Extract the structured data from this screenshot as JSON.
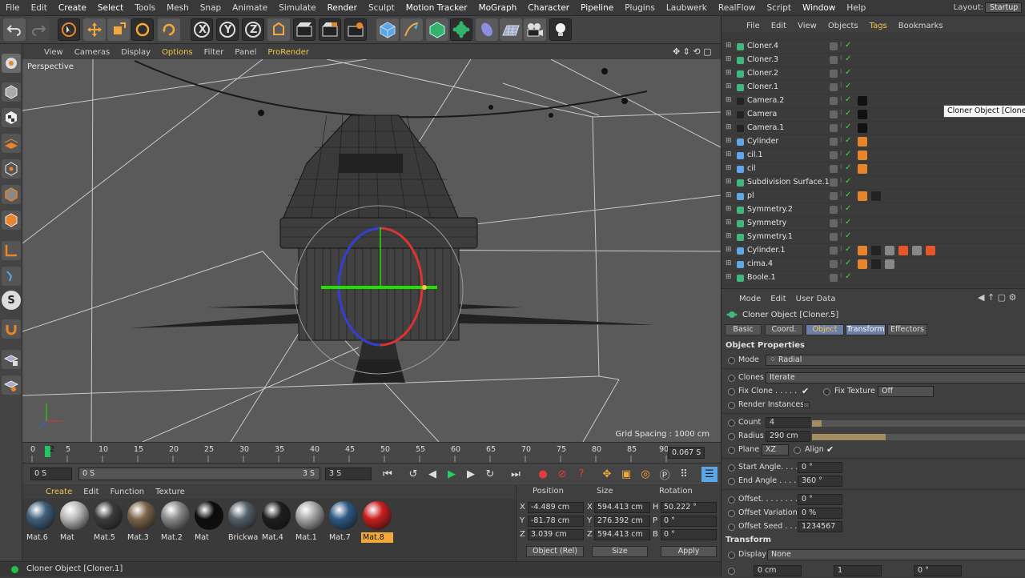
{
  "menu": [
    "File",
    "Edit",
    "Create",
    "Select",
    "Tools",
    "Mesh",
    "Snap",
    "Animate",
    "Simulate",
    "Render",
    "Sculpt",
    "Motion Tracker",
    "MoGraph",
    "Character",
    "Pipeline",
    "Plugins",
    "Laubwerk",
    "RealFlow",
    "Script",
    "Window",
    "Help"
  ],
  "layout": {
    "label": "Layout:",
    "value": "Startup"
  },
  "toolbar_axes": [
    "X",
    "Y",
    "Z"
  ],
  "viewport_menu": [
    "View",
    "Cameras",
    "Display",
    "Options",
    "Filter",
    "Panel",
    "ProRender"
  ],
  "viewport": {
    "label": "Perspective",
    "grid_spacing": "Grid Spacing : 1000 cm"
  },
  "timeline": {
    "ticks": [
      "0",
      "2",
      "5",
      "10",
      "15",
      "20",
      "25",
      "30",
      "35",
      "40",
      "45",
      "50",
      "55",
      "60",
      "65",
      "70",
      "75",
      "80",
      "85",
      "90"
    ],
    "current_frame": "2",
    "frame_field": "0.067 S"
  },
  "transport": {
    "start": "0 S",
    "range_start": "0 S",
    "range_end": "3 S",
    "end": "3 S"
  },
  "material_menu": [
    "Create",
    "Edit",
    "Function",
    "Texture"
  ],
  "materials": [
    {
      "name": "Mat.6",
      "color": "#3f5f7c"
    },
    {
      "name": "Mat",
      "color": "#b9b9b9"
    },
    {
      "name": "Mat.5",
      "color": "#3b3b3b"
    },
    {
      "name": "Mat.3",
      "color": "#7a6548"
    },
    {
      "name": "Mat.2",
      "color": "#8a8a8a"
    },
    {
      "name": "Mat",
      "color": "#0c0c0c"
    },
    {
      "name": "Brickwa",
      "color": "#55606a"
    },
    {
      "name": "Mat.4",
      "color": "#1d1d1d"
    },
    {
      "name": "Mat.1",
      "color": "#a7a7a7"
    },
    {
      "name": "Mat.7",
      "color": "#2d5a85"
    },
    {
      "name": "Mat.8",
      "color": "#c81e1e"
    }
  ],
  "selected_material": "Mat.8",
  "coords": {
    "headers": [
      "Position",
      "Size",
      "Rotation"
    ],
    "rows": [
      {
        "axis": "X",
        "pos": "-4.489 cm",
        "size_axis": "X",
        "size": "594.413 cm",
        "rot_axis": "H",
        "rot": "50.222 °"
      },
      {
        "axis": "Y",
        "pos": "-81.78 cm",
        "size_axis": "Y",
        "size": "276.392 cm",
        "rot_axis": "P",
        "rot": "0 °"
      },
      {
        "axis": "Z",
        "pos": "3.039 cm",
        "size_axis": "Z",
        "size": "594.413 cm",
        "rot_axis": "B",
        "rot": "0 °"
      }
    ],
    "mode": "Object (Rel)",
    "size_mode": "Size",
    "apply": "Apply"
  },
  "status": "Cloner Object [Cloner.1]",
  "object_menu": [
    "File",
    "Edit",
    "View",
    "Objects",
    "Tags",
    "Bookmarks"
  ],
  "objects": [
    {
      "name": "Cloner.4",
      "icon": "#3fb87e"
    },
    {
      "name": "Cloner.3",
      "icon": "#3fb87e"
    },
    {
      "name": "Cloner.2",
      "icon": "#3fb87e"
    },
    {
      "name": "Cloner.1",
      "icon": "#3fb87e"
    },
    {
      "name": "Camera.2",
      "icon": "#222222"
    },
    {
      "name": "Camera",
      "icon": "#222222"
    },
    {
      "name": "Camera.1",
      "icon": "#222222"
    },
    {
      "name": "Cylinder",
      "icon": "#5fa8e8"
    },
    {
      "name": "cil.1",
      "icon": "#5fa8e8"
    },
    {
      "name": "cil",
      "icon": "#5fa8e8"
    },
    {
      "name": "Subdivision Surface.1",
      "icon": "#3fb87e"
    },
    {
      "name": "pl",
      "icon": "#5fa8e8"
    },
    {
      "name": "Symmetry.2",
      "icon": "#3fb87e"
    },
    {
      "name": "Symmetry",
      "icon": "#3fb87e"
    },
    {
      "name": "Symmetry.1",
      "icon": "#3fb87e"
    },
    {
      "name": "Cylinder.1",
      "icon": "#5fa8e8"
    },
    {
      "name": "cima.4",
      "icon": "#5fa8e8"
    },
    {
      "name": "Boole.1",
      "icon": "#3fb87e"
    }
  ],
  "tooltip": "Cloner Object [Cloner.",
  "attr_menu": [
    "Mode",
    "Edit",
    "User Data"
  ],
  "attr_title": "Cloner Object [Cloner.5]",
  "attr_tabs": [
    "Basic",
    "Coord.",
    "Object",
    "Transform",
    "Effectors"
  ],
  "attr_selected_tab": "Object",
  "object_properties": {
    "section": "Object Properties",
    "mode_label": "Mode",
    "mode_value": "Radial",
    "clones_label": "Clones",
    "clones_value": "Iterate",
    "fix_clone_label": "Fix Clone . . . . .",
    "fix_texture_label": "Fix Texture",
    "fix_texture_value": "Off",
    "render_instances_label": "Render Instances",
    "count_label": "Count",
    "count_value": "4",
    "radius_label": "Radius",
    "radius_value": "290 cm",
    "plane_label": "Plane",
    "plane_value": "XZ",
    "align_label": "Align",
    "start_angle_label": "Start Angle. . . .",
    "start_angle_value": "0 °",
    "end_angle_label": "End Angle . . . .",
    "end_angle_value": "360 °",
    "offset_label": "Offset. . . . . . . .",
    "offset_value": "0 °",
    "offset_var_label": "Offset Variation",
    "offset_var_value": "0 %",
    "offset_seed_label": "Offset Seed . . .",
    "offset_seed_value": "1234567",
    "transform_section": "Transform",
    "display_label": "Display",
    "display_value": "None",
    "p_row_x": "0 cm",
    "s_row_x": "1",
    "r_row_h": "0 °"
  }
}
